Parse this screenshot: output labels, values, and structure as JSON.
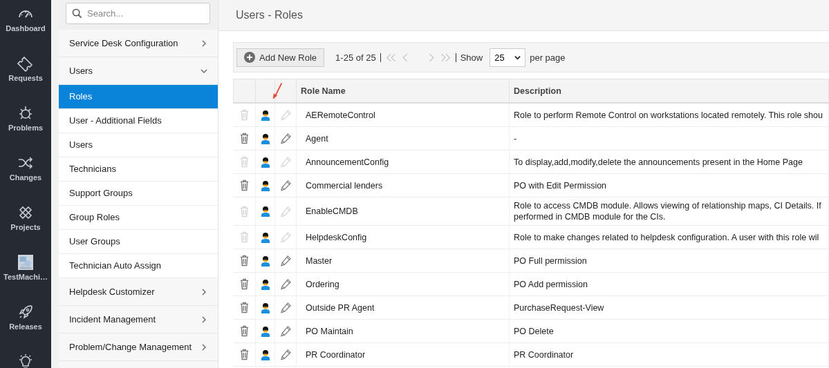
{
  "nav": [
    {
      "label": "Dashboard",
      "selected": false
    },
    {
      "label": "Requests",
      "selected": false
    },
    {
      "label": "Problems",
      "selected": false
    },
    {
      "label": "Changes",
      "selected": false
    },
    {
      "label": "Projects",
      "selected": false
    },
    {
      "label": "TestMachi…",
      "selected": false,
      "kind": "picture"
    },
    {
      "label": "Releases",
      "selected": false
    },
    {
      "selected": false
    }
  ],
  "sidebar": {
    "search": {
      "placeholder": "Search..."
    },
    "sections": [
      {
        "label": "Service Desk Configuration",
        "expanded": false
      },
      {
        "label": "Users",
        "expanded": true,
        "children": [
          {
            "label": "Roles",
            "selected": true
          },
          {
            "label": "User - Additional Fields",
            "selected": false
          },
          {
            "label": "Users",
            "selected": false
          },
          {
            "label": "Technicians",
            "selected": false
          },
          {
            "label": "Support Groups",
            "selected": false
          },
          {
            "label": "Group Roles",
            "selected": false
          },
          {
            "label": "User Groups",
            "selected": false
          },
          {
            "label": "Technician Auto Assign",
            "selected": false
          }
        ]
      },
      {
        "label": "Helpdesk Customizer",
        "expanded": false
      },
      {
        "label": "Incident Management",
        "expanded": false
      },
      {
        "label": "Problem/Change Management",
        "expanded": false
      }
    ]
  },
  "page": {
    "title": "Users - Roles"
  },
  "toolbar": {
    "add_button": "Add New Role",
    "range": "1-25 of 25",
    "show_label": "Show",
    "per_page": "25",
    "per_page_suffix": "per page"
  },
  "table": {
    "columns": [
      "Role Name",
      "Description"
    ],
    "rows": [
      {
        "name": "AERemoteControl",
        "description": "Role to perform Remote Control on workstations located remotely. This role shou",
        "disabled": true
      },
      {
        "name": "Agent",
        "description": "-",
        "disabled": false
      },
      {
        "name": "AnnouncementConfig",
        "description": "To display,add,modify,delete the announcements present in the Home Page",
        "disabled": true
      },
      {
        "name": "Commercial lenders",
        "description": "PO with Edit Permission",
        "disabled": false
      },
      {
        "name": "EnableCMDB",
        "description": "Role to access CMDB module. Allows viewing of relationship maps, CI Details. If\nperformed in CMDB module for the CIs.",
        "disabled": true
      },
      {
        "name": "HelpdeskConfig",
        "description": "Role to make changes related to helpdesk configuration. A user with this role wil",
        "disabled": true
      },
      {
        "name": "Master",
        "description": "PO Full permission",
        "disabled": false
      },
      {
        "name": "Ordering",
        "description": "PO Add permission",
        "disabled": false
      },
      {
        "name": "Outside PR Agent",
        "description": "PurchaseRequest-View",
        "disabled": false
      },
      {
        "name": "PO Maintain",
        "description": "PO Delete",
        "disabled": false
      },
      {
        "name": "PR Coordinator",
        "description": "PR Coordinator",
        "disabled": false
      }
    ]
  }
}
